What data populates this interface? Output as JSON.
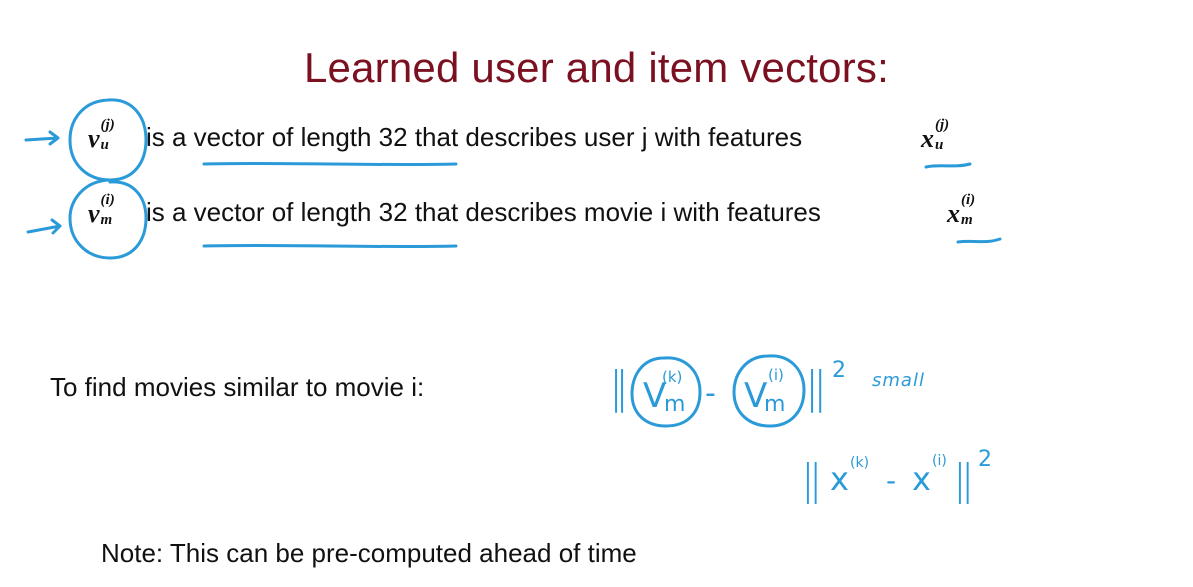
{
  "slide": {
    "title": "Learned user and item vectors:",
    "user_line": {
      "symbol": "v",
      "sup": "(j)",
      "sub": "u",
      "text": "is a vector of length 32 that describes user j with features",
      "feature_symbol": "x",
      "feature_sup": "(j)",
      "feature_sub": "u"
    },
    "movie_line": {
      "symbol": "v",
      "sup": "(i)",
      "sub": "m",
      "text": "is a vector of length 32 that describes movie i with features",
      "feature_symbol": "x",
      "feature_sup": "(i)",
      "feature_sub": "m"
    },
    "similar_text": "To find movies similar to movie i:",
    "note_text": "Note: This can be pre-computed ahead of time"
  },
  "handwriting": {
    "color": "#2a9ad8",
    "formula1": {
      "bars_left": "||",
      "v1": "V",
      "v1_sup": "(k)",
      "v1_sub": "m",
      "minus": "-",
      "v2": "V",
      "v2_sup": "(i)",
      "v2_sub": "m",
      "bars_right": "||",
      "power": "2",
      "note": "small"
    },
    "formula2": {
      "bars_left": "||",
      "x1": "x",
      "x1_sup": "(k)",
      "minus": "-",
      "x2": "x",
      "x2_sup": "(i)",
      "bars_right": "||",
      "power": "2"
    }
  },
  "colors": {
    "title": "#7a1020",
    "text": "#111111",
    "annotation": "#2a9ad8"
  }
}
